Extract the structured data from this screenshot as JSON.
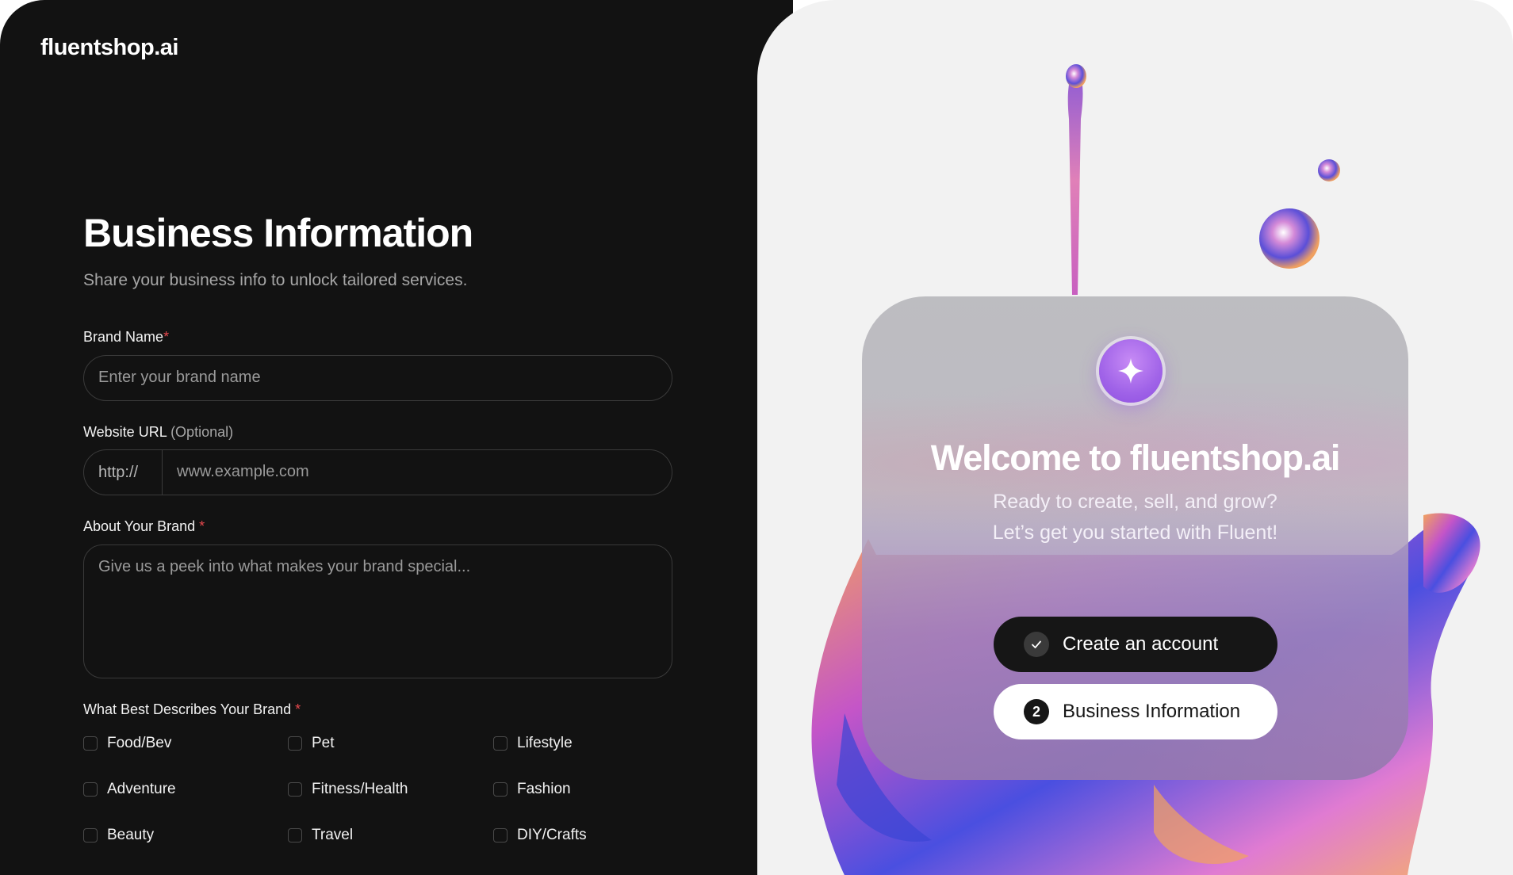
{
  "brand": {
    "logo": "fluentshop.ai"
  },
  "form": {
    "title": "Business Information",
    "subtitle": "Share your business info to unlock tailored services.",
    "brand_name": {
      "label": "Brand Name",
      "required_mark": "*",
      "placeholder": "Enter your brand name"
    },
    "website": {
      "label": "Website URL",
      "optional_text": "(Optional)",
      "prefix": "http://",
      "placeholder": "www.example.com"
    },
    "about": {
      "label": "About Your Brand",
      "required_mark": "*",
      "placeholder": "Give us a peek into what makes your brand special..."
    },
    "categories": {
      "label": "What Best Describes Your Brand",
      "required_mark": "*",
      "options": [
        "Food/Bev",
        "Pet",
        "Lifestyle",
        "Adventure",
        "Fitness/Health",
        "Fashion",
        "Beauty",
        "Travel",
        "DIY/Crafts"
      ]
    }
  },
  "welcome": {
    "title": "Welcome to fluentshop.ai",
    "line1": "Ready to create, sell, and grow?",
    "line2": "Let’s get you started with Fluent!",
    "steps": [
      {
        "label": "Create an account",
        "state": "completed",
        "icon": "check-icon"
      },
      {
        "label": "Business Information",
        "state": "current",
        "number": "2"
      }
    ]
  },
  "colors": {
    "panel_dark": "#121212",
    "panel_light": "#f2f2f2",
    "required": "#e5484d",
    "accent_purple": "#a063e8"
  }
}
